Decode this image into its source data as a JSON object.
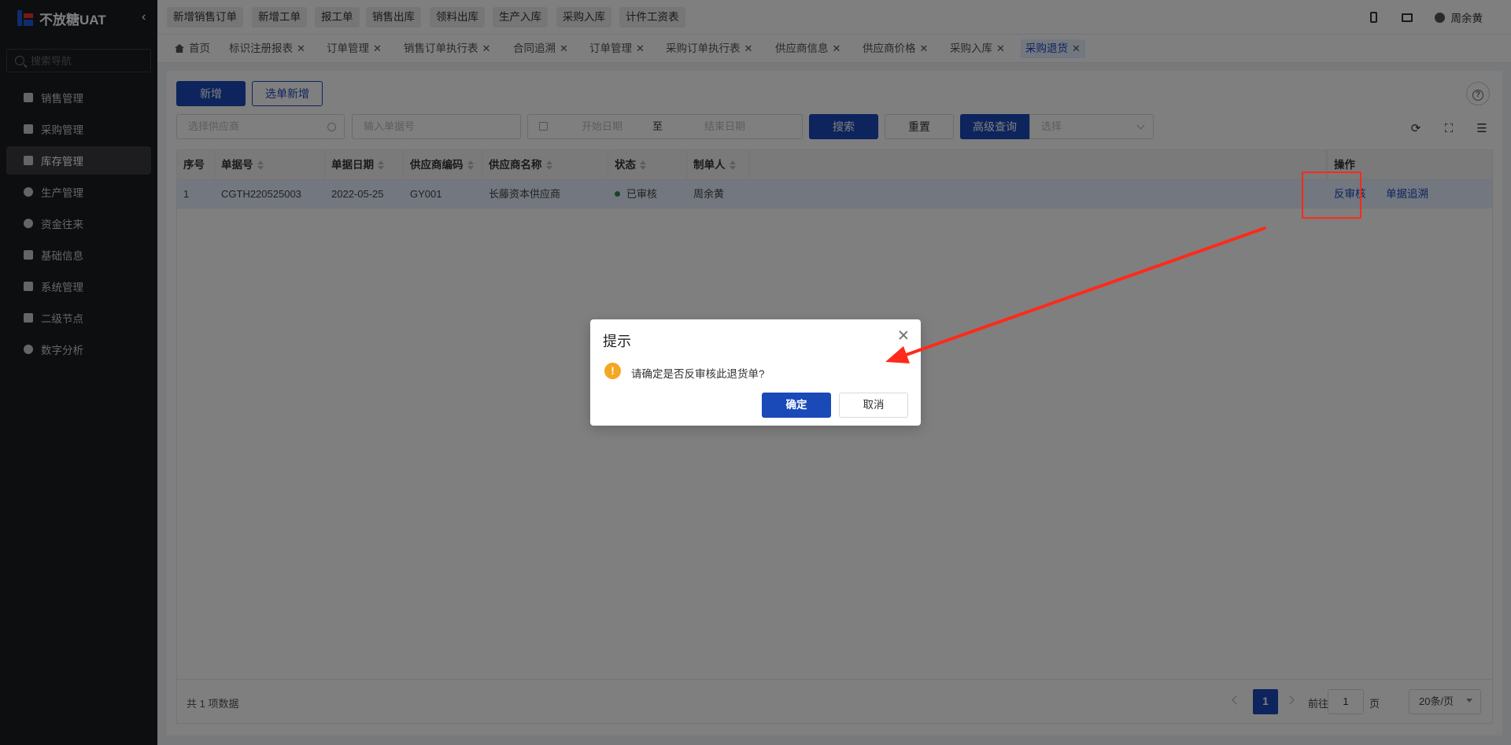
{
  "app": {
    "title": "不放糖UAT"
  },
  "sidebar": {
    "search_placeholder": "搜索导航",
    "items": [
      {
        "label": "销售管理",
        "icon": "tag-icon"
      },
      {
        "label": "采购管理",
        "icon": "cart-icon"
      },
      {
        "label": "库存管理",
        "icon": "warehouse-icon",
        "active": true
      },
      {
        "label": "生产管理",
        "icon": "factory-icon"
      },
      {
        "label": "资金往来",
        "icon": "money-icon"
      },
      {
        "label": "基础信息",
        "icon": "grid-icon"
      },
      {
        "label": "系统管理",
        "icon": "apps-icon"
      },
      {
        "label": "二级节点",
        "icon": "doc-icon"
      },
      {
        "label": "数字分析",
        "icon": "pie-icon"
      }
    ]
  },
  "topbar": {
    "quick": [
      "新增销售订单",
      "新增工单",
      "报工单",
      "销售出库",
      "领料出库",
      "生产入库",
      "采购入库",
      "计件工资表"
    ],
    "user": "周余黄"
  },
  "tabs": [
    {
      "label": "首页"
    },
    {
      "label": "标识注册报表"
    },
    {
      "label": "订单管理"
    },
    {
      "label": "销售订单执行表"
    },
    {
      "label": "合同追溯"
    },
    {
      "label": "订单管理"
    },
    {
      "label": "采购订单执行表"
    },
    {
      "label": "供应商信息"
    },
    {
      "label": "供应商价格"
    },
    {
      "label": "采购入库"
    },
    {
      "label": "采购退货",
      "active": true
    }
  ],
  "toolbar": {
    "add": "新增",
    "select_add": "选单新增",
    "supplier_placeholder": "选择供应商",
    "doc_placeholder": "输入单据号",
    "start_date": "开始日期",
    "date_sep": "至",
    "end_date": "结束日期",
    "search": "搜索",
    "reset": "重置",
    "advanced": "高级查询",
    "select_placeholder": "选择"
  },
  "table": {
    "columns": [
      "序号",
      "单据号",
      "单据日期",
      "供应商编码",
      "供应商名称",
      "状态",
      "制单人",
      "操作"
    ],
    "rows": [
      {
        "index": "1",
        "doc_no": "CGTH220525003",
        "date": "2022-05-25",
        "supplier_code": "GY001",
        "supplier_name": "长藤资本供应商",
        "status": "已审核",
        "creator": "周余黄",
        "op1": "反审核",
        "op2": "单据追溯"
      }
    ]
  },
  "pagination": {
    "total": "共 1 项数据",
    "current": "1",
    "goto_label": "前往",
    "goto_value": "1",
    "page_unit": "页",
    "page_size": "20条/页"
  },
  "dialog": {
    "title": "提示",
    "message": "请确定是否反审核此退货单?",
    "ok": "确定",
    "cancel": "取消"
  },
  "colors": {
    "primary": "#1a49b8",
    "sidebar_bg": "#1b1c1e",
    "warning": "#f5a623",
    "annotation": "#ff2a1a"
  }
}
